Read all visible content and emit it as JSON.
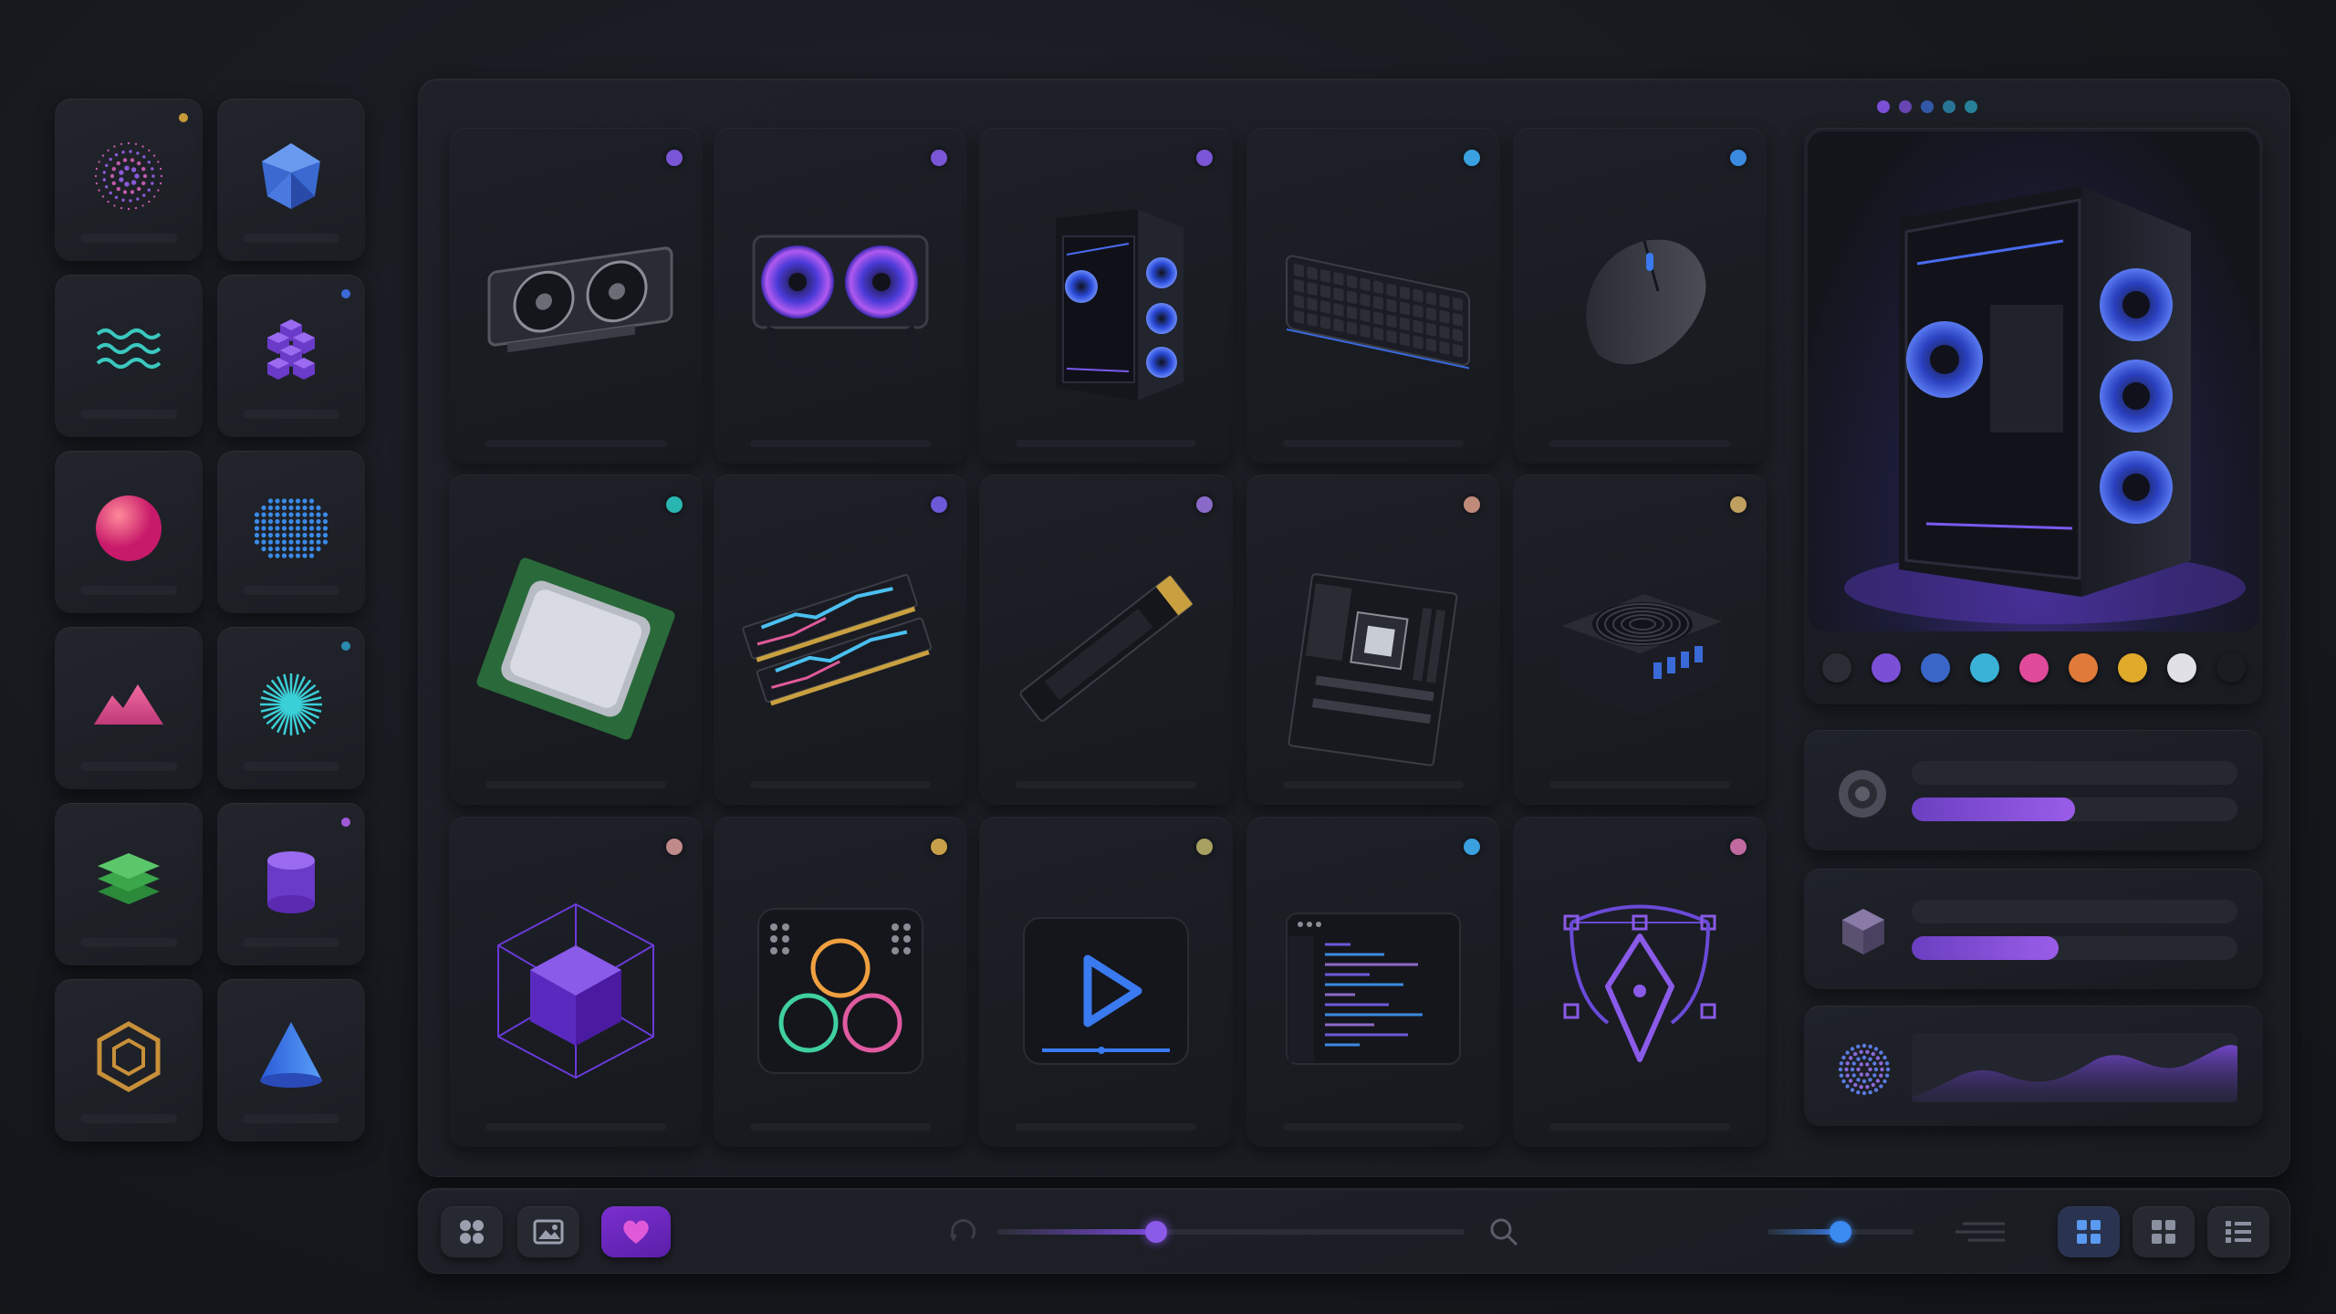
{
  "sidebar": {
    "tiles": [
      {
        "icon": "particle-burst-icon",
        "dot": "#c89a3a"
      },
      {
        "icon": "gem-icon",
        "dot": null
      },
      {
        "icon": "waves-icon",
        "dot": null
      },
      {
        "icon": "cubes-icon",
        "dot": "#3a6ad8"
      },
      {
        "icon": "sphere-icon",
        "dot": null
      },
      {
        "icon": "dot-sphere-icon",
        "dot": null
      },
      {
        "icon": "mountains-icon",
        "dot": null
      },
      {
        "icon": "starburst-icon",
        "dot": "#2a8ab0"
      },
      {
        "icon": "layers-icon",
        "dot": null
      },
      {
        "icon": "cylinder-icon",
        "dot": "#a05ad8"
      },
      {
        "icon": "hex-cube-icon",
        "dot": null
      },
      {
        "icon": "cone-icon",
        "dot": null
      }
    ]
  },
  "grid": {
    "cards": [
      {
        "name": "graphics-card",
        "dot": "#7a55d6"
      },
      {
        "name": "liquid-cooler",
        "dot": "#7a55d6"
      },
      {
        "name": "pc-case",
        "dot": "#7a55d6"
      },
      {
        "name": "keyboard",
        "dot": "#3aa0e0"
      },
      {
        "name": "mouse",
        "dot": "#3a8ae0"
      },
      {
        "name": "cpu",
        "dot": "#2ab6b0"
      },
      {
        "name": "ram",
        "dot": "#6a5ad8"
      },
      {
        "name": "ssd",
        "dot": "#8a6ac8"
      },
      {
        "name": "motherboard",
        "dot": "#c08a7a"
      },
      {
        "name": "power-supply",
        "dot": "#c0a060"
      },
      {
        "name": "3d-cube-app",
        "dot": "#c08a8a"
      },
      {
        "name": "color-grading-app",
        "dot": "#c8a04a"
      },
      {
        "name": "video-player-app",
        "dot": "#a8a060"
      },
      {
        "name": "code-editor-app",
        "dot": "#3aa0e0"
      },
      {
        "name": "vector-pen-app",
        "dot": "#c06aa0"
      }
    ]
  },
  "preview": {
    "swatches": [
      "#2b2d35",
      "#7b4fd6",
      "#3a66c8",
      "#3ab2d8",
      "#e04a9a",
      "#e07a3a",
      "#e0aa2a",
      "#e0e0e6",
      "#1a1c22"
    ]
  },
  "stats": [
    {
      "icon": "disc-icon",
      "progress": 0.5
    },
    {
      "icon": "cube-icon",
      "progress": 0.45
    },
    {
      "icon": "particle-sphere-icon",
      "progress": null
    }
  ],
  "pagination": {
    "count": 5,
    "active": 0,
    "colors": [
      "#7b4fd6",
      "#7b4fd6",
      "#3a66c8",
      "#2a8ab0",
      "#2a9ab8"
    ]
  },
  "toolbar": {
    "zoom_progress": 0.34,
    "size_progress": 0.5,
    "view_active": "grid-large"
  }
}
